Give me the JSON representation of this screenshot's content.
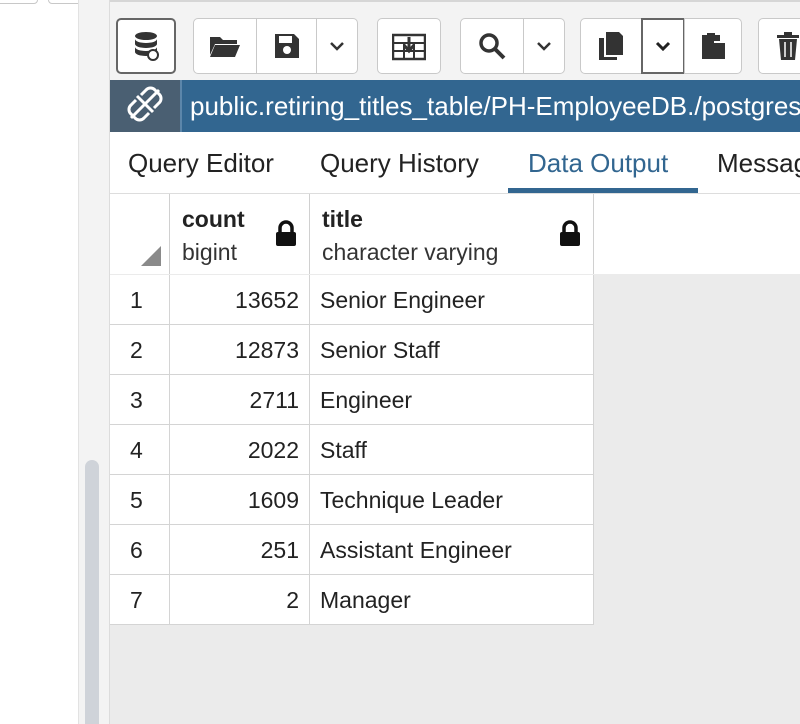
{
  "query": {
    "title": "public.retiring_titles_table/PH-EmployeeDB./postgres"
  },
  "toolbar": {
    "buttons": [
      {
        "name": "database-icon"
      },
      {
        "name": "folder-open-icon"
      },
      {
        "name": "save-icon"
      },
      {
        "name": "chevron-down-icon"
      },
      {
        "name": "download-icon"
      },
      {
        "name": "search-icon"
      },
      {
        "name": "chevron-down-icon"
      },
      {
        "name": "copy-icon"
      },
      {
        "name": "chevron-down-icon"
      },
      {
        "name": "paste-icon"
      },
      {
        "name": "trash-icon"
      }
    ]
  },
  "tabs": [
    {
      "label": "Query Editor",
      "active": false
    },
    {
      "label": "Query History",
      "active": false
    },
    {
      "label": "Data Output",
      "active": true
    },
    {
      "label": "Messages",
      "active": false
    }
  ],
  "grid": {
    "columns": [
      {
        "name": "count",
        "type": "bigint",
        "locked": true
      },
      {
        "name": "title",
        "type": "character varying",
        "locked": true
      }
    ],
    "rows": [
      {
        "n": "1",
        "count": "13652",
        "title": "Senior Engineer"
      },
      {
        "n": "2",
        "count": "12873",
        "title": "Senior Staff"
      },
      {
        "n": "3",
        "count": "2711",
        "title": "Engineer"
      },
      {
        "n": "4",
        "count": "2022",
        "title": "Staff"
      },
      {
        "n": "5",
        "count": "1609",
        "title": "Technique Leader"
      },
      {
        "n": "6",
        "count": "251",
        "title": "Assistant Engineer"
      },
      {
        "n": "7",
        "count": "2",
        "title": "Manager"
      }
    ]
  },
  "colors": {
    "accent": "#326690",
    "title_bar": "#326690"
  }
}
